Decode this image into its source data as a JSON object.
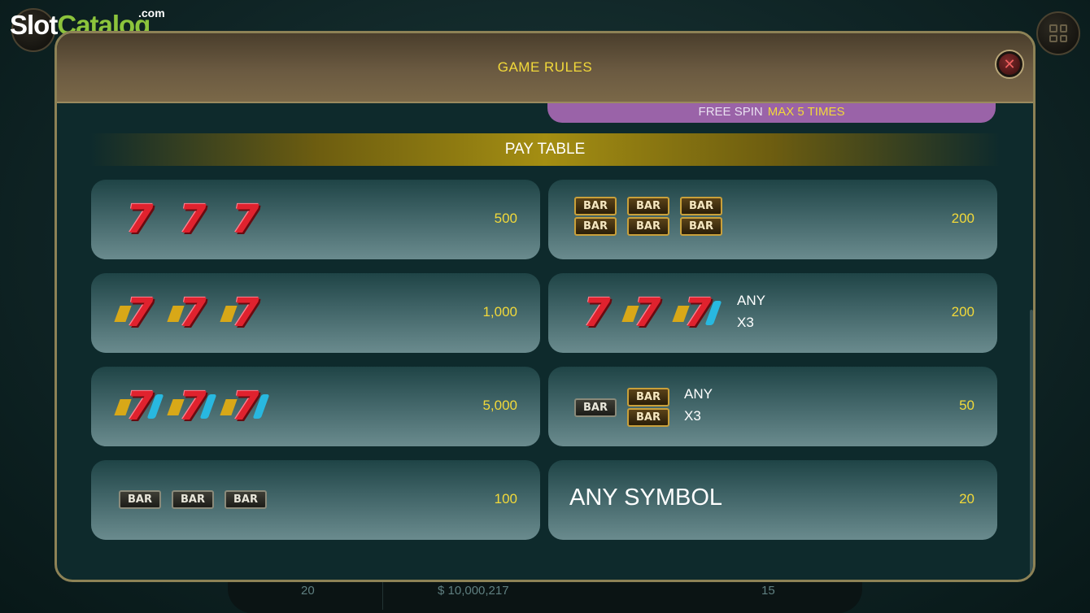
{
  "watermark": {
    "slot": "Slot",
    "catalog": "Catalog",
    "com": ".com"
  },
  "background": {
    "bet": "20",
    "balance": "$ 10,000,217",
    "lines": "15"
  },
  "modal": {
    "title": "GAME RULES",
    "close_icon": "close-icon",
    "free_spin": {
      "label": "FREE SPIN",
      "value": "MAX 5 TIMES"
    },
    "paytable_title": "PAY TABLE",
    "rows": [
      {
        "symbol": "three-red-sevens",
        "payout": "500"
      },
      {
        "symbol": "three-gold-wing-sevens",
        "payout": "1,000"
      },
      {
        "symbol": "three-blue-gold-sevens",
        "payout": "5,000"
      },
      {
        "symbol": "three-single-bars",
        "payout": "100"
      },
      {
        "symbol": "three-double-bars",
        "payout": "200"
      },
      {
        "symbol": "any-three-sevens",
        "any": "ANY",
        "mult": "X3",
        "payout": "200"
      },
      {
        "symbol": "any-three-bars",
        "any": "ANY",
        "mult": "X3",
        "payout": "50"
      },
      {
        "symbol": "any-symbol",
        "label": "ANY SYMBOL",
        "payout": "20"
      }
    ],
    "bar_text": "BAR",
    "seven_text": "7"
  },
  "colors": {
    "accent_gold": "#f2d93a",
    "free_spin_bg": "#9a63a8",
    "header_brown": "#6b5a41"
  }
}
